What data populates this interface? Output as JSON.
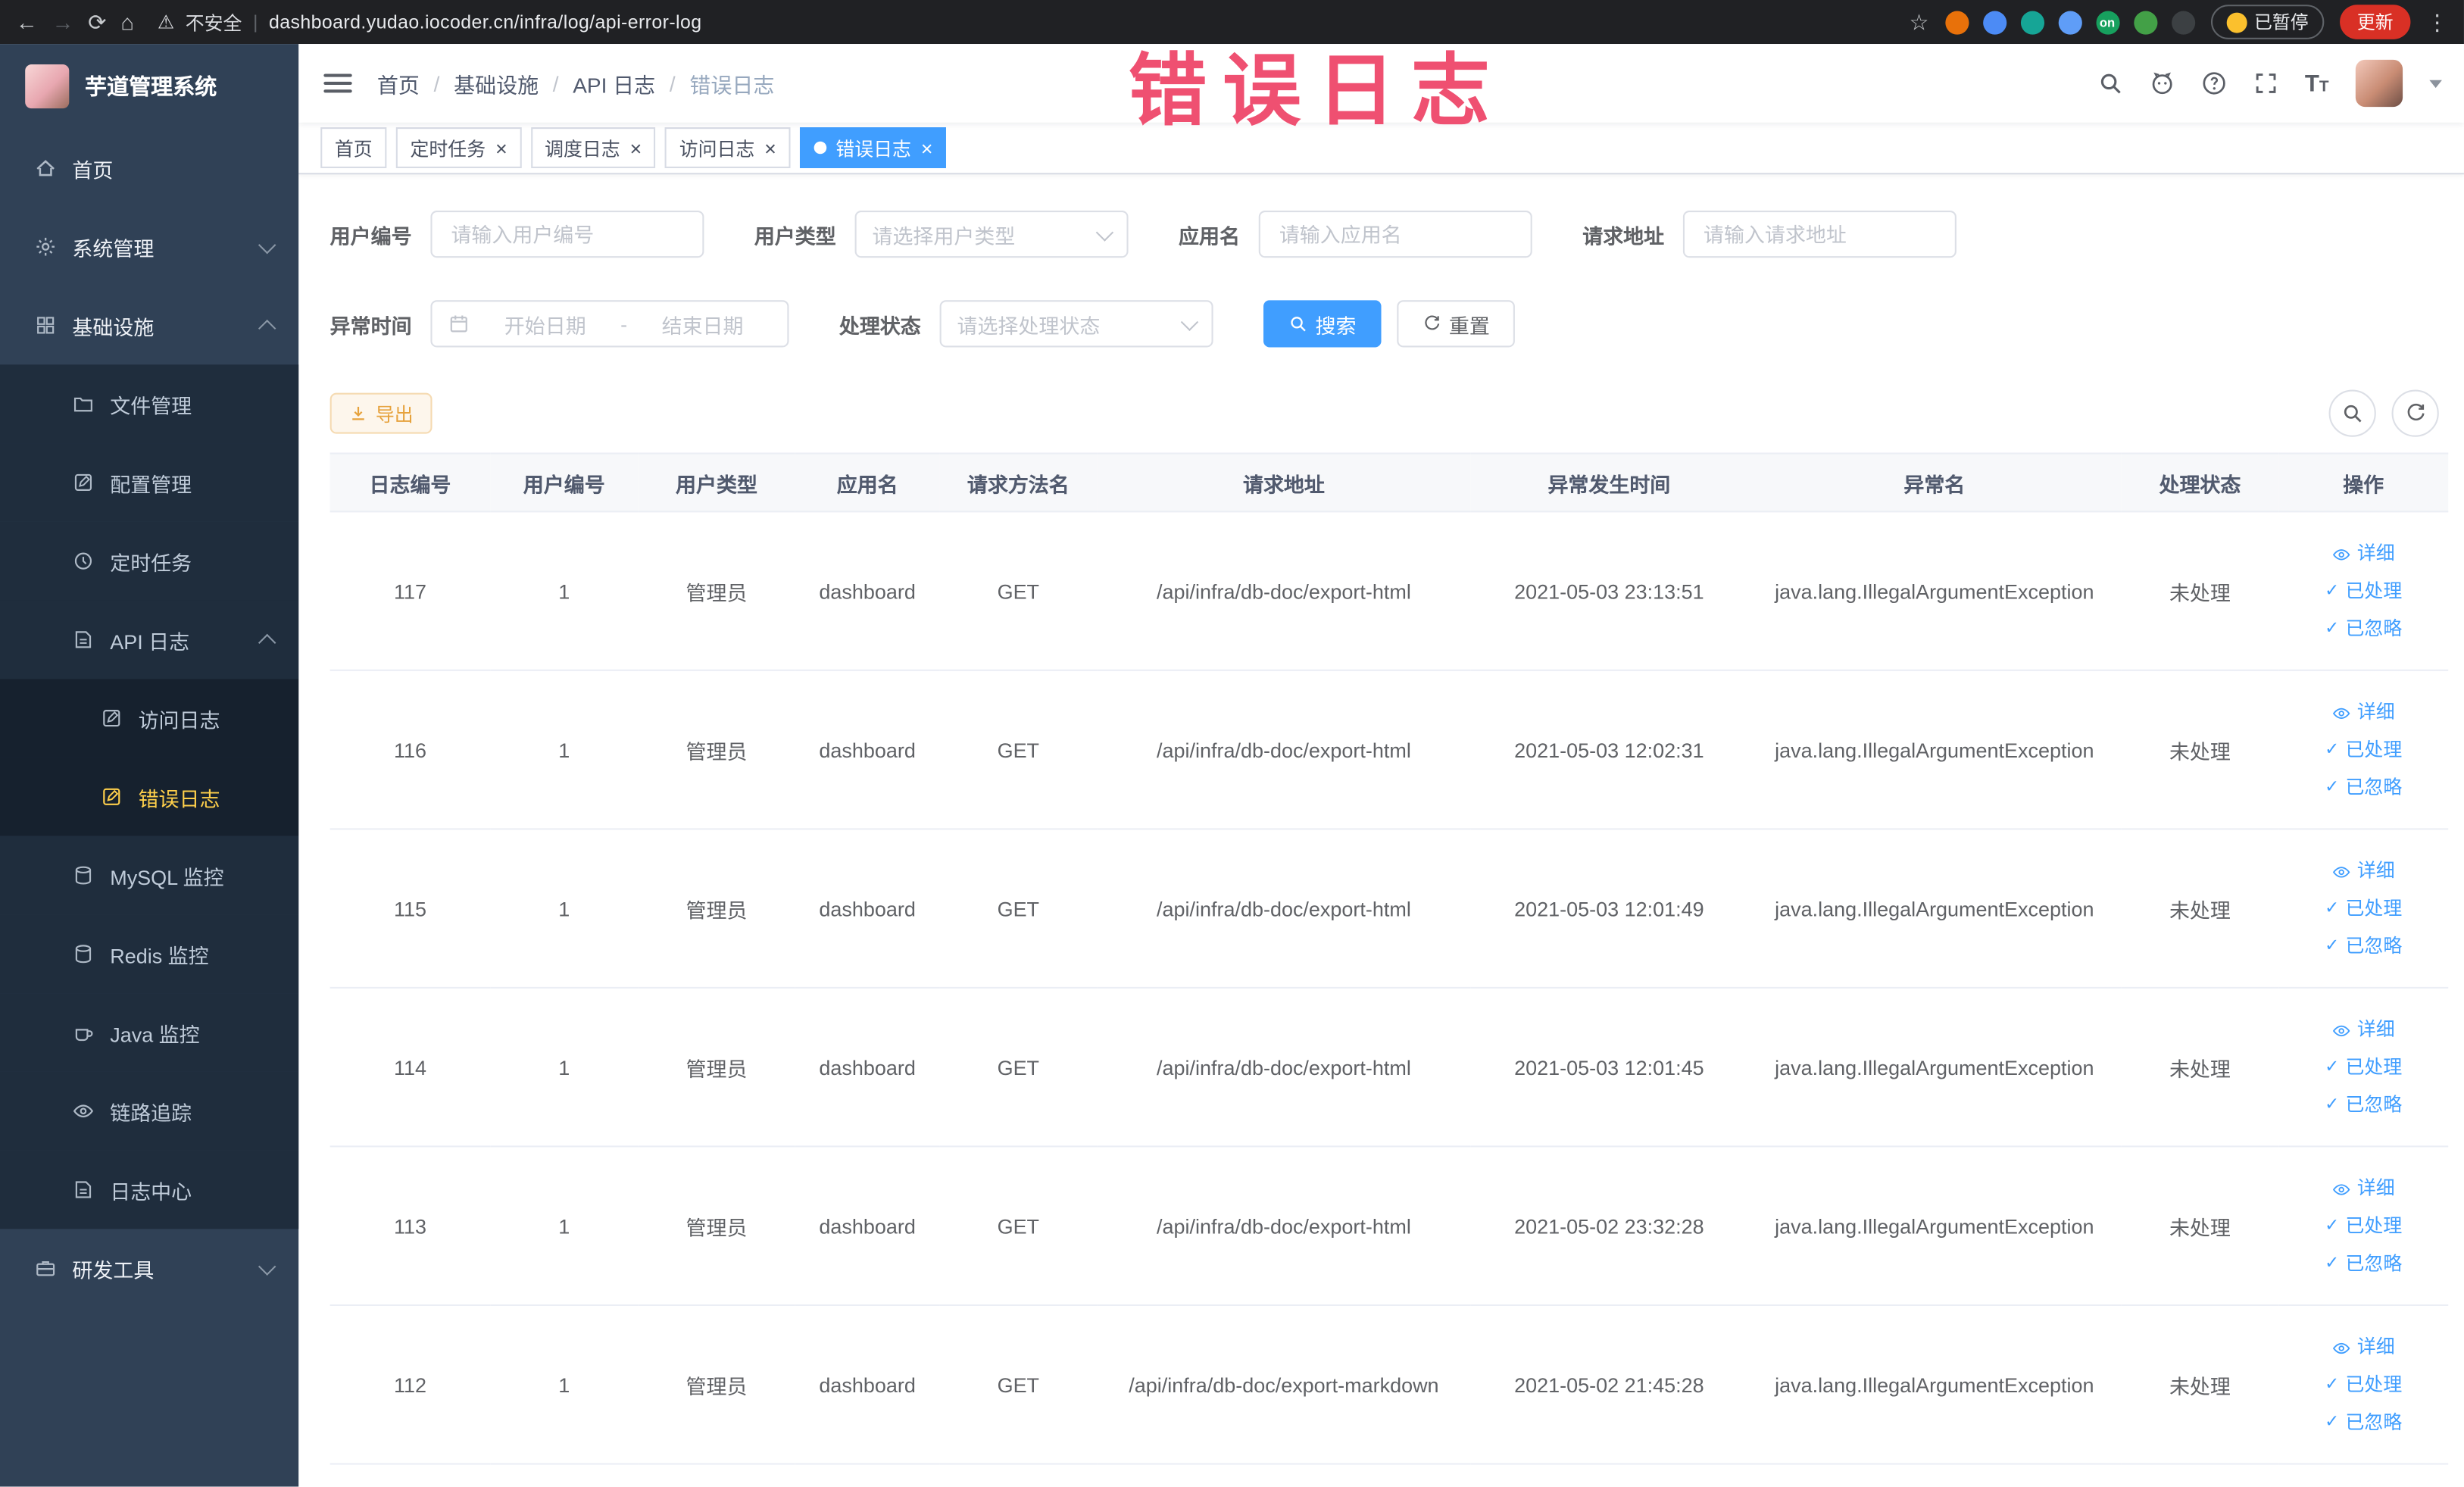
{
  "browser": {
    "security_warning": "不安全",
    "url": "dashboard.yudao.iocoder.cn/infra/log/api-error-log",
    "paused_label": "已暂停",
    "update_label": "更新",
    "extensions": [
      {
        "name": "extension-orange",
        "color": "#e8710a"
      },
      {
        "name": "extension-blue",
        "color": "#4c8bf5"
      },
      {
        "name": "extension-teal",
        "color": "#16a596"
      },
      {
        "name": "extension-grid",
        "color": "#5f9df7"
      },
      {
        "name": "extension-on-badge",
        "color": "#17a05e",
        "text": "on"
      },
      {
        "name": "extension-green",
        "color": "#43a047"
      },
      {
        "name": "extension-dark",
        "color": "#3c4043"
      }
    ]
  },
  "watermark": "错误日志",
  "sidebar": {
    "logo_title": "芋道管理系统",
    "items": [
      {
        "id": "home",
        "label": "首页",
        "icon": "home-icon",
        "level": 1
      },
      {
        "id": "system",
        "label": "系统管理",
        "icon": "gear-icon",
        "level": 1,
        "chevron": "down"
      },
      {
        "id": "infra",
        "label": "基础设施",
        "icon": "infra-icon",
        "level": 1,
        "chevron": "up"
      },
      {
        "id": "file",
        "label": "文件管理",
        "icon": "file-icon",
        "level": 2
      },
      {
        "id": "config",
        "label": "配置管理",
        "icon": "config-icon",
        "level": 2
      },
      {
        "id": "job",
        "label": "定时任务",
        "icon": "timer-icon",
        "level": 2
      },
      {
        "id": "api-log",
        "label": "API 日志",
        "icon": "apilog-icon",
        "level": 2,
        "chevron": "up"
      },
      {
        "id": "access-log",
        "label": "访问日志",
        "icon": "doc-icon",
        "level": 3
      },
      {
        "id": "error-log",
        "label": "错误日志",
        "icon": "doc-icon",
        "level": 3,
        "active": true
      },
      {
        "id": "mysql",
        "label": "MySQL 监控",
        "icon": "mysql-icon",
        "level": 2
      },
      {
        "id": "redis",
        "label": "Redis 监控",
        "icon": "redis-icon",
        "level": 2
      },
      {
        "id": "java",
        "label": "Java 监控",
        "icon": "java-icon",
        "level": 2
      },
      {
        "id": "trace",
        "label": "链路追踪",
        "icon": "trace-icon",
        "level": 2
      },
      {
        "id": "log-center",
        "label": "日志中心",
        "icon": "logcenter-icon",
        "level": 2
      },
      {
        "id": "dev-tools",
        "label": "研发工具",
        "icon": "tools-icon",
        "level": 1,
        "chevron": "down"
      }
    ]
  },
  "navbar": {
    "breadcrumb": [
      "首页",
      "基础设施",
      "API 日志",
      "错误日志"
    ]
  },
  "tabs": [
    {
      "id": "home",
      "label": "首页",
      "closable": false,
      "active": false
    },
    {
      "id": "cron-job",
      "label": "定时任务",
      "closable": true,
      "active": false
    },
    {
      "id": "job-log",
      "label": "调度日志",
      "closable": true,
      "active": false
    },
    {
      "id": "access-log",
      "label": "访问日志",
      "closable": true,
      "active": false
    },
    {
      "id": "error-log",
      "label": "错误日志",
      "closable": true,
      "active": true
    }
  ],
  "filters": {
    "user_id_label": "用户编号",
    "user_id_placeholder": "请输入用户编号",
    "user_type_label": "用户类型",
    "user_type_placeholder": "请选择用户类型",
    "app_name_label": "应用名",
    "app_name_placeholder": "请输入应用名",
    "request_url_label": "请求地址",
    "request_url_placeholder": "请输入请求地址",
    "exception_time_label": "异常时间",
    "date_start_placeholder": "开始日期",
    "date_separator": "-",
    "date_end_placeholder": "结束日期",
    "process_status_label": "处理状态",
    "process_status_placeholder": "请选择处理状态",
    "search_label": "搜索",
    "reset_label": "重置"
  },
  "toolbar": {
    "export_label": "导出"
  },
  "table": {
    "columns": [
      "日志编号",
      "用户编号",
      "用户类型",
      "应用名",
      "请求方法名",
      "请求地址",
      "异常发生时间",
      "异常名",
      "处理状态",
      "操作"
    ],
    "actions": [
      "详细",
      "已处理",
      "已忽略"
    ],
    "rows": [
      {
        "id": "117",
        "user_id": "1",
        "user_type": "管理员",
        "app": "dashboard",
        "method": "GET",
        "url": "/api/infra/db-doc/export-html",
        "time": "2021-05-03 23:13:51",
        "exception": "java.lang.IllegalArgumentException",
        "status": "未处理"
      },
      {
        "id": "116",
        "user_id": "1",
        "user_type": "管理员",
        "app": "dashboard",
        "method": "GET",
        "url": "/api/infra/db-doc/export-html",
        "time": "2021-05-03 12:02:31",
        "exception": "java.lang.IllegalArgumentException",
        "status": "未处理"
      },
      {
        "id": "115",
        "user_id": "1",
        "user_type": "管理员",
        "app": "dashboard",
        "method": "GET",
        "url": "/api/infra/db-doc/export-html",
        "time": "2021-05-03 12:01:49",
        "exception": "java.lang.IllegalArgumentException",
        "status": "未处理"
      },
      {
        "id": "114",
        "user_id": "1",
        "user_type": "管理员",
        "app": "dashboard",
        "method": "GET",
        "url": "/api/infra/db-doc/export-html",
        "time": "2021-05-03 12:01:45",
        "exception": "java.lang.IllegalArgumentException",
        "status": "未处理"
      },
      {
        "id": "113",
        "user_id": "1",
        "user_type": "管理员",
        "app": "dashboard",
        "method": "GET",
        "url": "/api/infra/db-doc/export-html",
        "time": "2021-05-02 23:32:28",
        "exception": "java.lang.IllegalArgumentException",
        "status": "未处理"
      },
      {
        "id": "112",
        "user_id": "1",
        "user_type": "管理员",
        "app": "dashboard",
        "method": "GET",
        "url": "/api/infra/db-doc/export-markdown",
        "time": "2021-05-02 21:45:28",
        "exception": "java.lang.IllegalArgumentException",
        "status": "未处理"
      }
    ]
  },
  "colors": {
    "accent": "#409eff",
    "sidebar_bg": "#304156",
    "submenu_bg": "#1f2d3d",
    "active_menu_text": "#ffd04b",
    "watermark": "#ee4266"
  }
}
